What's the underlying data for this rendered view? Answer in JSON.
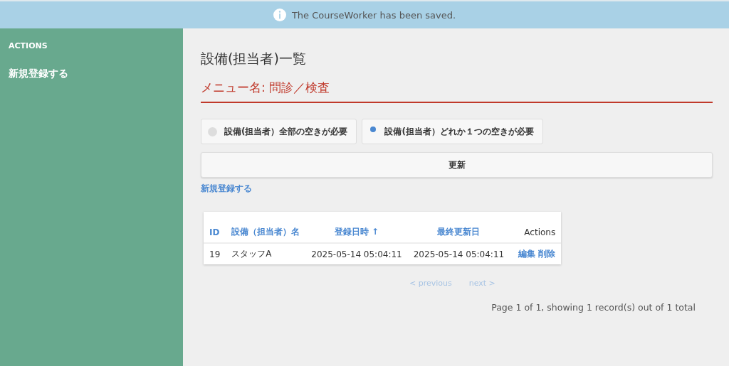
{
  "flash": {
    "message": "The CourseWorker has been saved."
  },
  "sidebar": {
    "heading": "ACTIONS",
    "items": [
      "新規登録する"
    ]
  },
  "page": {
    "title": "設備(担当者)一覧",
    "menu_name": "メニュー名: 問診／検査"
  },
  "options": [
    {
      "label": "設備(担当者）全部の空きが必要",
      "selected": false
    },
    {
      "label": "設備(担当者）どれか１つの空きが必要",
      "selected": true
    }
  ],
  "update_button": "更新",
  "new_link": "新規登録する",
  "table": {
    "columns": [
      {
        "label": "ID",
        "kind": "sort"
      },
      {
        "label": "設備（担当者）名",
        "kind": "sort"
      },
      {
        "label": "登録日時 ↑",
        "kind": "sort"
      },
      {
        "label": "最終更新日",
        "kind": "sort"
      },
      {
        "label": "Actions",
        "kind": "plain"
      }
    ],
    "rows": [
      {
        "cells": [
          "19",
          "スタッフA",
          "2025-05-14 05:04:11",
          "2025-05-14 05:04:11"
        ],
        "actions": [
          "編集",
          "削除"
        ]
      }
    ]
  },
  "pagination": {
    "previous": {
      "label": "< previous",
      "disabled": true
    },
    "next": {
      "label": "next >",
      "disabled": true
    },
    "summary": "Page 1 of 1, showing 1 record(s) out of 1 total"
  }
}
